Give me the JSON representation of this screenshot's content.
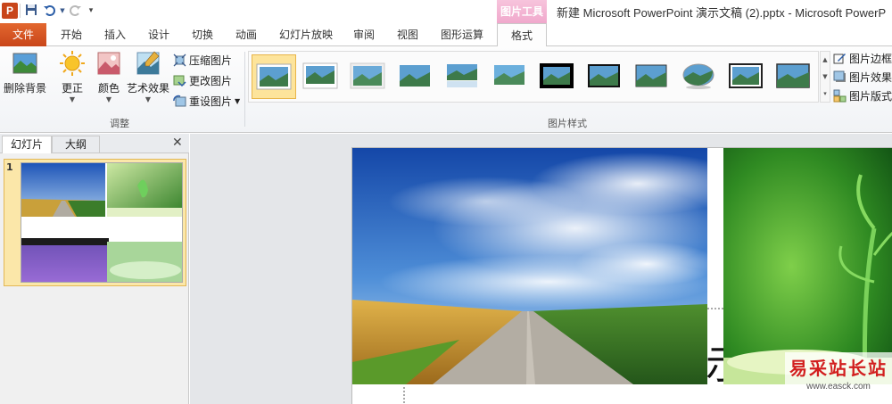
{
  "app": {
    "logo_letter": "P",
    "context_tab_group": "图片工具",
    "window_title": "新建 Microsoft PowerPoint 演示文稿 (2).pptx  -  Microsoft PowerP"
  },
  "qat": {
    "save_icon": "save-icon",
    "undo_icon": "undo-icon",
    "redo_icon": "redo-icon",
    "customize_icon": "customize-icon"
  },
  "tabs": [
    {
      "label": "文件"
    },
    {
      "label": "开始"
    },
    {
      "label": "插入"
    },
    {
      "label": "设计"
    },
    {
      "label": "切换"
    },
    {
      "label": "动画"
    },
    {
      "label": "幻灯片放映"
    },
    {
      "label": "审阅"
    },
    {
      "label": "视图"
    },
    {
      "label": "图形运算"
    },
    {
      "label": "格式"
    }
  ],
  "ribbon": {
    "adjust": {
      "remove_bg": "删除背景",
      "corrections": "更正",
      "color": "颜色",
      "artistic": "艺术效果",
      "compress": "压缩图片",
      "change": "更改图片",
      "reset": "重设图片",
      "group_label": "调整"
    },
    "styles": {
      "group_label": "图片样式",
      "border": "图片边框",
      "effects": "图片效果",
      "layout": "图片版式"
    }
  },
  "leftpane": {
    "tab_slides": "幻灯片",
    "tab_outline": "大纲",
    "close": "✕",
    "slide_number": "1"
  },
  "slide": {
    "partial_char": "示"
  },
  "watermark": {
    "title": "易采站长站",
    "url": "www.easck.com"
  },
  "colors": {
    "file_tab": "#c9461a",
    "context_tab": "#f0a8cc",
    "selection": "#fde49b",
    "watermark": "#d21f1f"
  }
}
